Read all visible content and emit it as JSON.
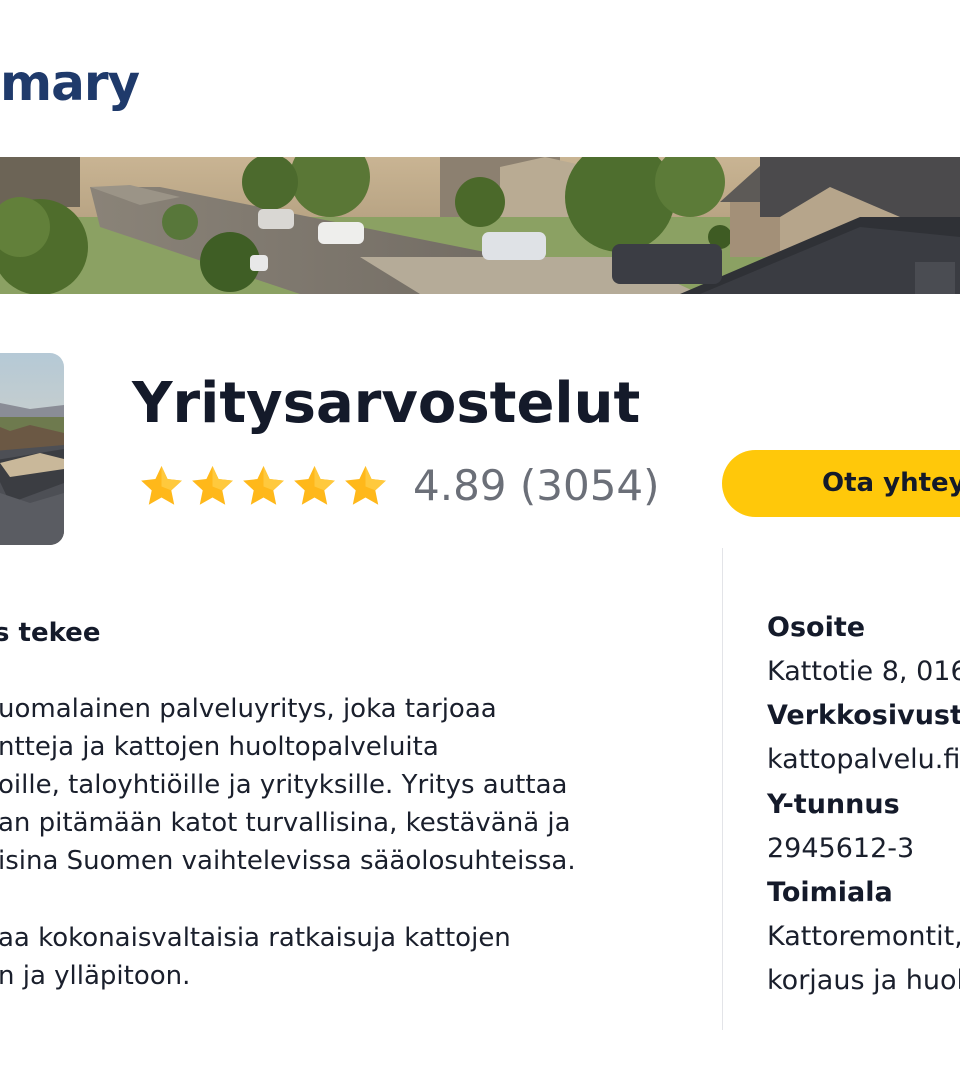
{
  "header": {
    "logo_text": "mary"
  },
  "company": {
    "title": "Yritysarvostelut",
    "rating_text": "4.89 (3054)",
    "star_color": "#ffb81a",
    "contact_button": "Ota yhtey"
  },
  "about": {
    "heading": "s tekee",
    "paragraph1": [
      "uomalainen palveluyritys, joka tarjoaa",
      "ntteja ja kattojen huoltopalveluita",
      "oille, taloyhtiöille ja yrityksille. Yritys auttaa",
      "an pitämään katot turvallisina, kestävänä ja",
      "isina Suomen vaihtelevissa sääolosuhteissa."
    ],
    "paragraph2": [
      "aa kokonaisvaltaisia ratkaisuja kattojen",
      "n ja ylläpitoon."
    ]
  },
  "info": {
    "address_label": "Osoite",
    "address_value": "Kattotie 8, 016",
    "website_label": "Verkkosivusto",
    "website_value": "kattopalvelu.fi",
    "business_id_label": "Y-tunnus",
    "business_id_value": "2945612-3",
    "industry_label": "Toimiala",
    "industry_value_line1": "Kattoremontit,",
    "industry_value_line2": "korjaus ja huol"
  },
  "colors": {
    "logo": "#1f3a6b",
    "button": "#ffc80a",
    "rating_text": "#6b6f78"
  }
}
